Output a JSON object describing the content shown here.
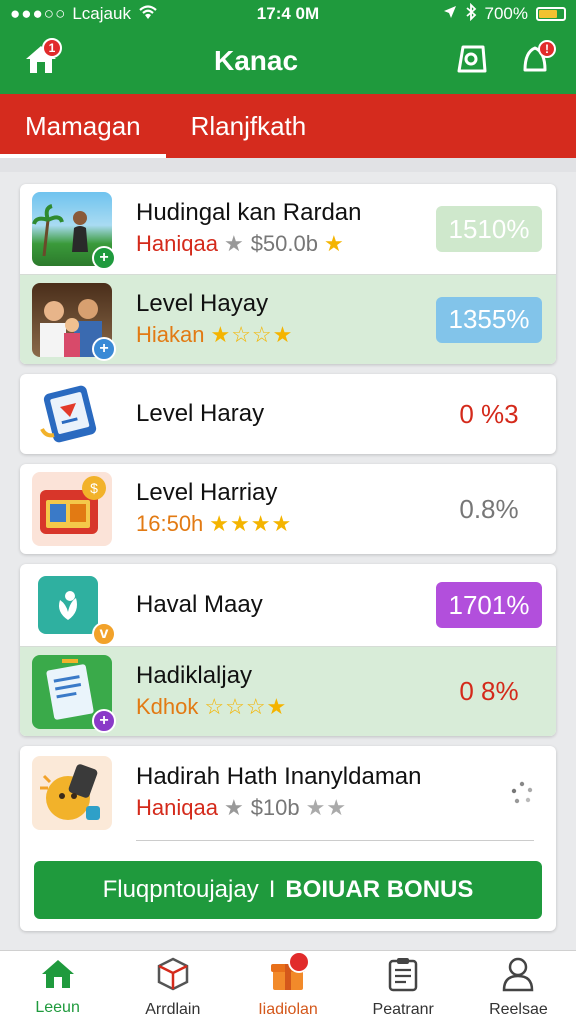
{
  "status_bar": {
    "carrier": "Lcajauk",
    "signal_dots": "●●●○○",
    "time": "17:4 0M",
    "battery_text": "700%",
    "battery_level": 0.7,
    "battery_color": "#f2c230"
  },
  "header": {
    "title": "Kanac",
    "home_badge": "1",
    "right_icon_badge": "!"
  },
  "tabs": [
    {
      "label": "Mamagan",
      "active": true
    },
    {
      "label": "Rlanjfkath",
      "active": false
    }
  ],
  "items": [
    {
      "name": "Hudingal kan Rardan",
      "sub_label": "Haniqaa",
      "sub_value": "$50.0b",
      "stars": "★",
      "percent": "1510%",
      "pill": "green",
      "highlight": false,
      "icon": "photo-beach-icon",
      "mini": "+"
    },
    {
      "name": "Level Hayay",
      "sub_label": "Hiakan",
      "sub_value": "",
      "stars": "★☆☆★",
      "percent": "1355%",
      "pill": "blue",
      "highlight": true,
      "icon": "family-photo-icon",
      "mini": "+"
    },
    {
      "name": "Level Haray",
      "sub_label": "",
      "sub_value": "",
      "stars": "",
      "percent": "0 %3",
      "pill": "red",
      "highlight": false,
      "icon": "tablet-icon",
      "mini": ""
    },
    {
      "name": "Level Harriay",
      "sub_label": "16:50h",
      "sub_value": "",
      "stars": "★★★★",
      "percent": "0.8%",
      "pill": "grey",
      "highlight": false,
      "icon": "calendar-icon",
      "mini": ""
    },
    {
      "name": "Haval Maay",
      "sub_label": "",
      "sub_value": "",
      "stars": "",
      "percent": "1701%",
      "pill": "purple",
      "highlight": false,
      "icon": "leaf-icon",
      "mini": "v"
    },
    {
      "name": "Hadiklaljay",
      "sub_label": "Kdhok",
      "sub_value": "",
      "stars": "☆☆☆★",
      "percent": "0 8%",
      "pill": "red",
      "highlight": true,
      "icon": "document-icon",
      "mini": "+"
    },
    {
      "name": "Hadirah Hath Inanyldaman",
      "sub_label": "Haniqaa",
      "sub_value": "$10b",
      "stars": "★★",
      "percent": "",
      "pill": "",
      "highlight": false,
      "icon": "fist-icon",
      "mini": ""
    }
  ],
  "cta": {
    "label_left": "Fluqpntoujajay",
    "separator": "I",
    "label_right": "BOIUAR BONUS"
  },
  "bottom_nav": [
    {
      "label": "Leeun",
      "icon": "home-icon",
      "active": true
    },
    {
      "label": "Arrdlain",
      "icon": "cube-icon",
      "active": false
    },
    {
      "label": "Iiadiolan",
      "icon": "gift-box-icon",
      "active": false,
      "badge": true
    },
    {
      "label": "Peatranr",
      "icon": "clipboard-icon",
      "active": false
    },
    {
      "label": "Reelsae",
      "icon": "user-icon",
      "active": false
    }
  ],
  "colors": {
    "brand_green": "#1f9a3d",
    "tab_red": "#d52b1e",
    "highlight_row": "#d8ecd8"
  }
}
